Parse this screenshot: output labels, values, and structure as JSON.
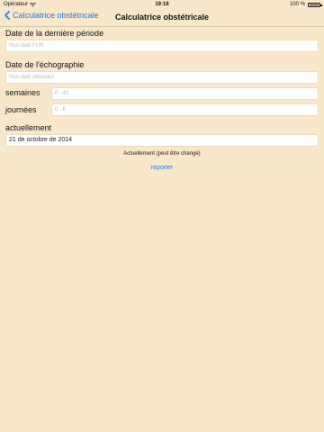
{
  "status": {
    "carrier": "Opérateur",
    "time": "19:16",
    "battery": "100 %"
  },
  "nav": {
    "back_label": "Calculatrice obstétricale",
    "title": "Calculatrice obstétricale"
  },
  "form": {
    "last_period_label": "Date de la dernière période",
    "last_period_placeholder": "Non daté FUR",
    "ultrasound_label": "Date de l'échographie",
    "ultrasound_placeholder": "Non daté ultrasons",
    "weeks_label": "semaines",
    "weeks_placeholder": "0 - 42",
    "days_label": "journées",
    "days_placeholder": "0 - 6",
    "current_label": "actuellement",
    "current_value": "21 de octobre de 2014",
    "current_note": "Actuellement (peut être changé)",
    "report_label": "reporter"
  },
  "colors": {
    "background": "#f9e7cb",
    "accent": "#1a7cf5"
  }
}
